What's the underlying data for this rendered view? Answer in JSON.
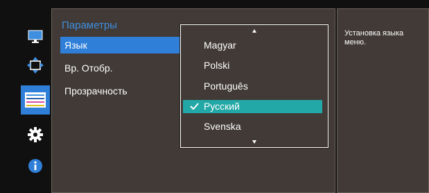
{
  "colors": {
    "background": "#101010",
    "panel": "#413a36",
    "menu_title": "#3f8fe0",
    "menu_highlight": "#2f7fd8",
    "dropdown_highlight": "#22a8a6",
    "text": "#ffffff"
  },
  "sidebar": {
    "icons": [
      {
        "name": "monitor-icon"
      },
      {
        "name": "position-icon"
      },
      {
        "name": "color-bars-icon"
      },
      {
        "name": "gear-icon"
      },
      {
        "name": "info-icon"
      }
    ]
  },
  "menu": {
    "title": "Параметры",
    "items": [
      {
        "label": "Язык",
        "selected": true
      },
      {
        "label": "Вр. Отобр.",
        "selected": false
      },
      {
        "label": "Прозрачность",
        "selected": false
      }
    ]
  },
  "dropdown": {
    "options": [
      {
        "label": "Magyar",
        "selected": false
      },
      {
        "label": "Polski",
        "selected": false
      },
      {
        "label": "Português",
        "selected": false
      },
      {
        "label": "Русский",
        "selected": true
      },
      {
        "label": "Svenska",
        "selected": false
      }
    ],
    "scroll_up_icon": "arrow-up-icon",
    "scroll_down_icon": "arrow-down-icon"
  },
  "help": {
    "text": "Установка языка меню."
  }
}
